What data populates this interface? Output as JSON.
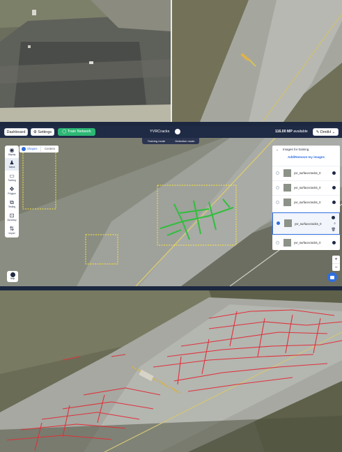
{
  "toolbar": {
    "dashboard_label": "Dashboard",
    "settings_label": "Settings",
    "train_label": "Train Network",
    "title": "YVRCracks",
    "mp_value": "116.00 MP",
    "mp_suffix": "available",
    "user_label": "DmitH"
  },
  "mode_tabs": [
    "Training mode",
    "Detection mode"
  ],
  "left_tools": [
    {
      "label": "Display",
      "icon": "eye-icon"
    },
    {
      "label": "Select",
      "icon": "select-icon"
    },
    {
      "label": "Training",
      "icon": "training-icon"
    },
    {
      "label": "Polygon",
      "icon": "polygon-icon"
    },
    {
      "label": "Testing",
      "icon": "testing-icon"
    },
    {
      "label": "Accuracy",
      "icon": "accuracy-icon"
    },
    {
      "label": "Import",
      "icon": "import-icon"
    }
  ],
  "help_label": "Help",
  "shape_tabs": [
    "Shapes",
    "Centers"
  ],
  "panel": {
    "title": "Images for training",
    "add_remove": "Add/Remove my images",
    "images": [
      {
        "name": "yvr_surfacecracks_0",
        "selected": false
      },
      {
        "name": "yvr_surfacecracks_0",
        "selected": false
      },
      {
        "name": "yvr_surfacecracks_0",
        "selected": false
      },
      {
        "name": "yvr_surfacecracks_0",
        "selected": true
      },
      {
        "name": "yvr_surfacecracks_0",
        "selected": false
      }
    ]
  },
  "zoom": {
    "in": "+",
    "out": "−"
  },
  "colors": {
    "accent": "#2f6ee0",
    "train": "#2db774",
    "annotation": "#2fbf3c",
    "selection_box": "#ffe93a",
    "crack": "#e0303a"
  }
}
